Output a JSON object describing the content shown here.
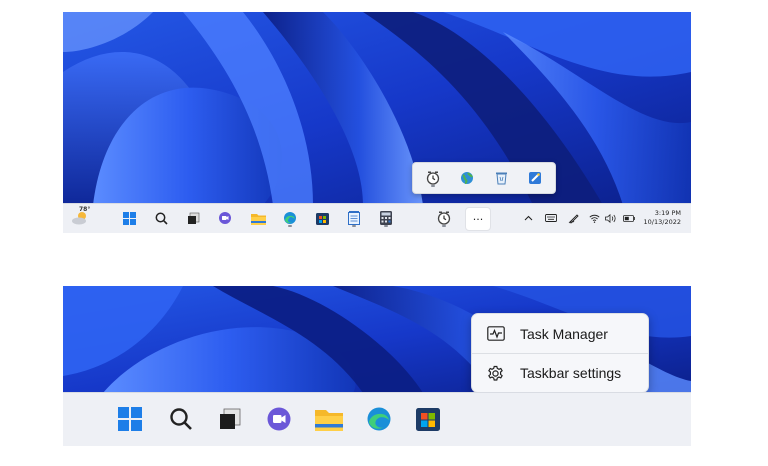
{
  "top": {
    "weather": {
      "temperature": "78°",
      "icon": "weather-partly-sunny-icon"
    },
    "more_button_label": "···",
    "clock": {
      "time": "3:19 PM",
      "date": "10/13/2022"
    },
    "pinned_icons": [
      "start-icon",
      "search-icon",
      "task-view-icon",
      "teams-chat-icon",
      "file-explorer-icon",
      "edge-icon",
      "store-icon",
      "notepad-icon",
      "calculator-icon",
      "clock-icon"
    ],
    "overflow_icons": [
      "clock-icon",
      "maps-globe-icon",
      "recycle-bin-icon",
      "paint-icon"
    ],
    "tray_icons": [
      "chevron-up-icon",
      "keyboard-icon",
      "pen-icon",
      "wifi-icon",
      "volume-icon",
      "battery-icon"
    ]
  },
  "bottom": {
    "context_menu": {
      "items": [
        {
          "label": "Task Manager",
          "icon": "task-manager-icon"
        },
        {
          "label": "Taskbar settings",
          "icon": "settings-gear-icon"
        }
      ]
    },
    "pinned_icons": [
      "start-icon",
      "search-icon",
      "task-view-icon",
      "teams-chat-icon",
      "file-explorer-icon",
      "edge-icon",
      "store-icon"
    ]
  },
  "colors": {
    "wallpaper_dark": "#0a1a6e",
    "wallpaper_bright": "#3a6cf5",
    "taskbar": "#eef0f5",
    "accent": "#0a64d6"
  }
}
